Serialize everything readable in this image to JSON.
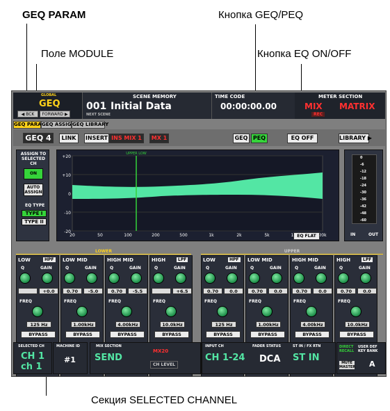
{
  "annotations": {
    "geq_param": "GEQ PARAM",
    "geq_peq_button": "Кнопка GEQ/PEQ",
    "module_field": "Поле MODULE",
    "eq_on_off_button": "Кнопка EQ ON/OFF",
    "selected_channel": "Секция SELECTED CHANNEL"
  },
  "topbar": {
    "global_label": "GLOBAL",
    "console": "GEQ",
    "back": "◀ BCK",
    "forward": "FORWARD ▶",
    "scene_memory_label": "SCENE MEMORY",
    "scene_number": "001",
    "scene_title": "Initial Data",
    "scene_next": "NEXT SCENE",
    "timecode_label": "TIME CODE",
    "timecode": "00:00:00.00",
    "meter_label": "METER SECTION",
    "meter_mix": "MIX",
    "meter_matrix": "MATRIX",
    "rec": "REC"
  },
  "tabs": [
    {
      "label": "GEQ PARAM"
    },
    {
      "label": "GEQ ASSIGN"
    },
    {
      "label": "GEQ LIBRARY"
    }
  ],
  "module": {
    "label": "GEQ 4",
    "link": "LINK",
    "insert_label": "INSERT",
    "insert_target": "INS MIX 1",
    "insert_target2": "MX 1",
    "geq": "GEQ",
    "peq": "PEQ",
    "eq_off": "EQ OFF",
    "library": "LIBRARY ▶"
  },
  "left_panel": {
    "assign_title": "ASSIGN TO SELECTED CH",
    "on": "ON",
    "auto_assign": "AUTO ASSIGN",
    "eq_type_label": "EQ TYPE",
    "type1": "TYPE I",
    "type2": "TYPE II"
  },
  "graph": {
    "y_ticks": [
      "+20",
      "+10",
      "0",
      "-10",
      "-20"
    ],
    "x_ticks": [
      "20",
      "50",
      "100",
      "200",
      "500",
      "1k",
      "2k",
      "5k",
      "10k",
      "20k"
    ],
    "marker_label": "UPPER LOW",
    "eq_flat": "EQ FLAT"
  },
  "meter": {
    "scale": [
      "0",
      "-6",
      "-12",
      "-18",
      "-24",
      "-30",
      "-36",
      "-42",
      "-48",
      "-60"
    ],
    "in": "IN",
    "out": "OUT"
  },
  "bands_lower_label": "LOWER",
  "bands_upper_label": "UPPER",
  "bands": [
    {
      "name": "LOW",
      "gain": "+0.0",
      "q": "",
      "freq": "125 Hz",
      "bypass": "BYPASS",
      "hpf": "HPF"
    },
    {
      "name": "LOW MID",
      "q": "0.70",
      "gain": "-5.0",
      "freq": "1.00kHz",
      "bypass": "BYPASS"
    },
    {
      "name": "HIGH MID",
      "q": "0.70",
      "gain": "-5.5",
      "freq": "4.00kHz",
      "bypass": "BYPASS"
    },
    {
      "name": "HIGH",
      "gain": "+6.5",
      "freq": "10.0kHz",
      "bypass": "BYPASS",
      "lpf": "LPF"
    },
    {
      "name": "LOW",
      "q": "0.70",
      "gain": "0.0",
      "freq": "125 Hz",
      "bypass": "BYPASS",
      "hpf": "HPF"
    },
    {
      "name": "LOW MID",
      "q": "0.70",
      "gain": "0.0",
      "freq": "1.00kHz",
      "bypass": "BYPASS"
    },
    {
      "name": "HIGH MID",
      "q": "0.70",
      "gain": "0.0",
      "freq": "4.00kHz",
      "bypass": "BYPASS"
    },
    {
      "name": "HIGH",
      "q": "0.70",
      "gain": "0.0",
      "freq": "10.0kHz",
      "bypass": "BYPASS",
      "lpf": "LPF"
    }
  ],
  "knob_labels": {
    "q": "Q",
    "gain": "GAIN",
    "freq": "FREQ"
  },
  "status": {
    "selected_ch_label": "SELECTED CH",
    "ch_top": "CH 1",
    "ch_bottom": "ch 1",
    "machine_label": "MACHINE ID",
    "machine_id": "#1",
    "mix_section_label": "MIX SECTION",
    "send": "SEND",
    "mx": "MX20",
    "ch_level": "CH LEVEL",
    "input_ch_label": "INPUT CH",
    "input_ch": "CH 1-24",
    "fader_status_label": "FADER STATUS",
    "dca": "DCA",
    "st_in_label": "ST IN / FX RTN",
    "st_in": "ST IN",
    "direct_recall": "DIRECT RECALL",
    "user_def_label": "USER DEF KEY BANK",
    "mute_master": "MUTE MASTER",
    "bank": "A"
  },
  "colors": {
    "accent": "#ffd21a",
    "on": "#35d43a",
    "curve": "#53e6a4",
    "panel": "#2e3340"
  }
}
